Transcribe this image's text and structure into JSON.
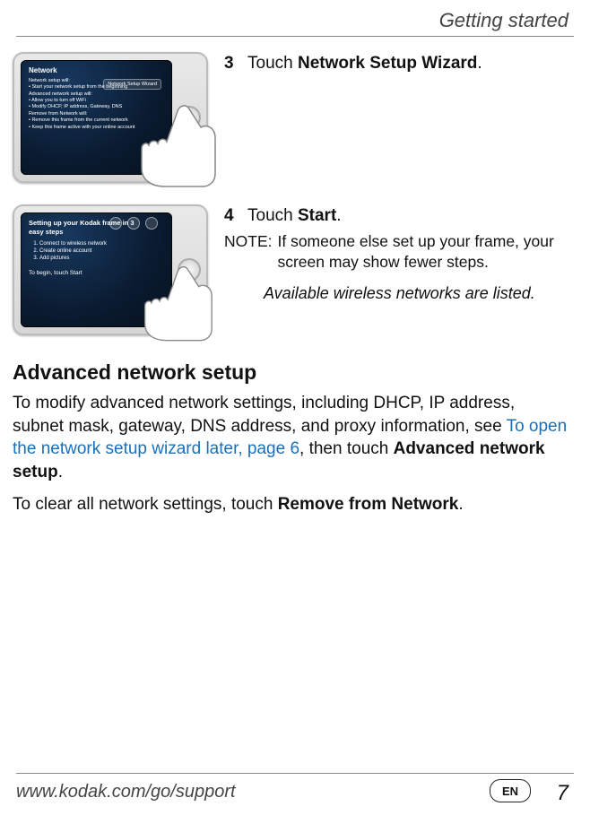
{
  "running_header": "Getting started",
  "steps": {
    "items": [
      {
        "num": "3",
        "prefix": "Touch ",
        "bold": "Network Setup Wizard",
        "suffix": ".",
        "screen_title": "Network",
        "screen_lines": "Network setup will:\n• Start your network setup from the beginning\nAdvanced network setup will:\n• Allow you to turn off WiFi\n• Modify DHCP, IP address, Gateway, DNS\nRemove from Network will:\n• Remove this frame from the current network\n• Keep this frame active with your online account",
        "screen_button": "Network Setup Wizard"
      },
      {
        "num": "4",
        "prefix": "Touch ",
        "bold": "Start",
        "suffix": ".",
        "note_label": "NOTE:",
        "note_text": "If someone else set up your frame, your screen may show fewer steps.",
        "avail": "Available wireless networks are listed.",
        "screen_title": "Setting up your Kodak frame in 3 easy steps",
        "screen_lines_list": [
          "Connect to wireless network",
          "Create online account",
          "Add pictures"
        ],
        "screen_footer": "To begin, touch Start"
      }
    ]
  },
  "section": {
    "heading": "Advanced network setup",
    "p1_a": "To modify advanced network settings, including DHCP, IP address, subnet mask, gateway, DNS address, and proxy information, see ",
    "p1_link": "To open the network setup wizard later, page 6",
    "p1_b": ", then touch ",
    "p1_bold": "Advanced network setup",
    "p1_c": ".",
    "p2_a": "To clear all network settings, touch ",
    "p2_bold": "Remove from Network",
    "p2_b": "."
  },
  "footer": {
    "url": "www.kodak.com/go/support",
    "lang": "EN",
    "page": "7"
  }
}
